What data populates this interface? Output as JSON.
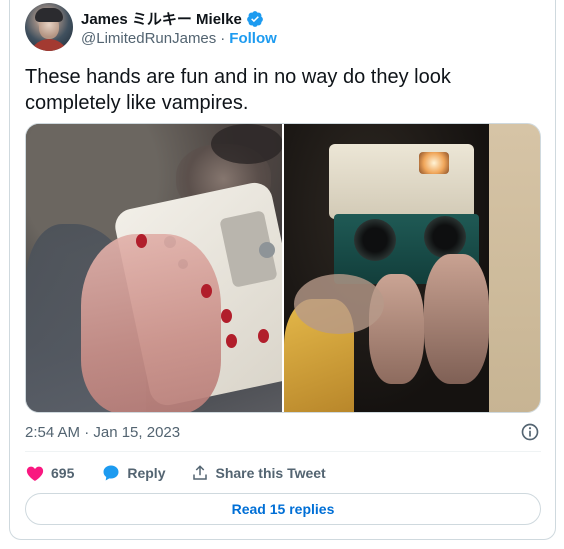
{
  "author": {
    "display_name": "James ミルキー Mielke",
    "handle": "@LimitedRunJames",
    "separator": "·",
    "follow_label": "Follow",
    "verified_color": "#1d9bf0"
  },
  "tweet": {
    "text": "These hands are fun and in no way do they look completely like vampires.",
    "timestamp": "2:54 AM · Jan 15, 2023"
  },
  "media": {
    "photos": [
      {
        "icon": "photo-hand-holding-white-gameboy"
      },
      {
        "icon": "photo-hands-holding-green-camera"
      }
    ]
  },
  "actions": {
    "like_count": "695",
    "like_color": "#f91880",
    "reply_label": "Reply",
    "reply_color": "#1d9bf0",
    "share_label": "Share this Tweet"
  },
  "footer": {
    "read_replies_label": "Read 15 replies",
    "link_color": "#006fd6"
  }
}
